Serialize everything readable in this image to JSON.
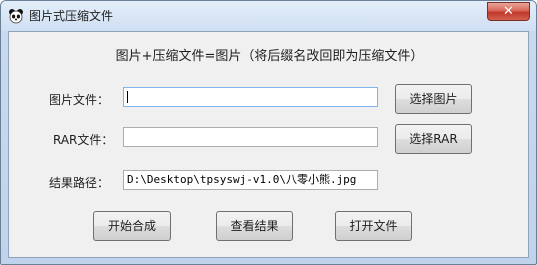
{
  "window": {
    "title": "图片式压缩文件",
    "app_icon": "panda-icon",
    "close_glyph": "✕"
  },
  "header": {
    "text": "图片+压缩文件=图片（将后缀名改回即为压缩文件）"
  },
  "form": {
    "image_label": "图片文件：",
    "image_value": "",
    "rar_label": "RAR文件：",
    "rar_value": "",
    "result_label": "结果路径：",
    "result_value": "D:\\Desktop\\tpsyswj-v1.0\\八零小熊.jpg"
  },
  "buttons": {
    "select_image": "选择图片",
    "select_rar": "选择RAR",
    "start": "开始合成",
    "view_result": "查看结果",
    "open_file": "打开文件"
  }
}
